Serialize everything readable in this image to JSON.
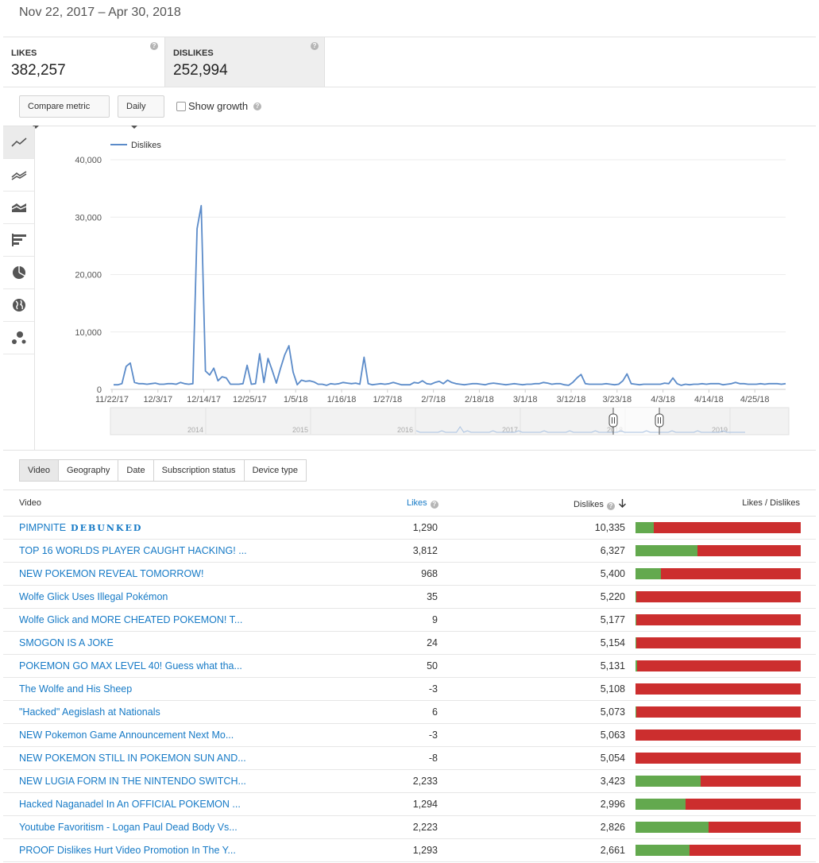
{
  "date_range": "Nov 22, 2017 – Apr 30, 2018",
  "metrics": [
    {
      "label": "LIKES",
      "value": "382,257",
      "help": "?"
    },
    {
      "label": "DISLIKES",
      "value": "252,994",
      "help": "?"
    }
  ],
  "controls": {
    "compare_metric": "Compare metric",
    "interval": "Daily",
    "show_growth": "Show growth",
    "help": "?"
  },
  "chart_icons": [
    "line-chart-icon",
    "multi-line-chart-icon",
    "stacked-area-chart-icon",
    "bar-chart-icon",
    "pie-chart-icon",
    "globe-map-icon",
    "bubble-chart-icon"
  ],
  "chart_data": {
    "type": "line",
    "legend": "Dislikes",
    "legend_color": "#5b8bc9",
    "ylim": [
      0,
      40000
    ],
    "yticks": [
      "40,000",
      "30,000",
      "20,000",
      "10,000",
      "0"
    ],
    "xticks": [
      "11/22/17",
      "12/3/17",
      "12/14/17",
      "12/25/17",
      "1/5/18",
      "1/16/18",
      "1/27/18",
      "2/7/18",
      "2/18/18",
      "3/1/18",
      "3/12/18",
      "3/23/18",
      "4/3/18",
      "4/14/18",
      "4/25/18"
    ],
    "grid": true,
    "series": [
      {
        "name": "Dislikes",
        "values": [
          800,
          800,
          1000,
          4000,
          4600,
          1200,
          1000,
          1000,
          900,
          1000,
          1100,
          900,
          900,
          1000,
          1000,
          900,
          1200,
          1000,
          900,
          1000,
          28000,
          32000,
          3200,
          2500,
          3700,
          1500,
          2200,
          2000,
          900,
          900,
          900,
          1000,
          4200,
          900,
          1000,
          6200,
          1200,
          5400,
          3300,
          1100,
          3700,
          6000,
          7600,
          3000,
          800,
          1600,
          1400,
          1500,
          1300,
          900,
          900,
          700,
          1000,
          900,
          1000,
          1200,
          1100,
          1000,
          1100,
          900,
          5600,
          1000,
          800,
          900,
          1000,
          900,
          1000,
          1200,
          1000,
          800,
          800,
          800,
          1200,
          1100,
          1500,
          1000,
          900,
          1200,
          1400,
          1000,
          1600,
          1200,
          1000,
          900,
          800,
          900,
          1000,
          1000,
          900,
          800,
          1000,
          1100,
          1000,
          900,
          800,
          900,
          1000,
          900,
          800,
          900,
          900,
          1000,
          1000,
          1200,
          1100,
          900,
          1000,
          1000,
          800,
          700,
          1200,
          2000,
          2600,
          1000,
          900,
          900,
          900,
          900,
          1000,
          900,
          800,
          900,
          1500,
          2700,
          1000,
          900,
          800,
          900,
          900,
          900,
          900,
          900,
          1100,
          1000,
          2000,
          1000,
          700,
          900,
          800,
          900,
          900,
          1000,
          900,
          1000,
          1000,
          1000,
          800,
          900,
          1000,
          1200,
          1000,
          1000,
          900,
          900,
          900,
          1000,
          900,
          1000,
          1000,
          1000,
          900,
          1000
        ]
      }
    ],
    "navigator": {
      "years": [
        "2014",
        "2015",
        "2016",
        "2017",
        "2018",
        "2019"
      ]
    }
  },
  "tabs": [
    "Video",
    "Geography",
    "Date",
    "Subscription status",
    "Device type"
  ],
  "table": {
    "headers": {
      "video": "Video",
      "likes": "Likes",
      "dislikes": "Dislikes",
      "ratio": "Likes / Dislikes"
    },
    "rows": [
      {
        "title": "PIMPNITE",
        "title_suffix": "DEBUNKED",
        "likes": "1,290",
        "dislikes": "10,335",
        "like_fraction": 0.111
      },
      {
        "title": "TOP 16 WORLDS PLAYER CAUGHT HACKING! ...",
        "likes": "3,812",
        "dislikes": "6,327",
        "like_fraction": 0.376
      },
      {
        "title": "NEW POKEMON REVEAL TOMORROW!",
        "likes": "968",
        "dislikes": "5,400",
        "like_fraction": 0.152
      },
      {
        "title": "Wolfe Glick Uses Illegal Pokémon",
        "likes": "35",
        "dislikes": "5,220",
        "like_fraction": 0.007
      },
      {
        "title": "Wolfe Glick and MORE CHEATED POKEMON! T...",
        "likes": "9",
        "dislikes": "5,177",
        "like_fraction": 0.002
      },
      {
        "title": "SMOGON IS A JOKE",
        "likes": "24",
        "dislikes": "5,154",
        "like_fraction": 0.005
      },
      {
        "title": "POKEMON GO MAX LEVEL 40! Guess what tha...",
        "likes": "50",
        "dislikes": "5,131",
        "like_fraction": 0.01
      },
      {
        "title": "The Wolfe and His Sheep",
        "likes": "-3",
        "dislikes": "5,108",
        "like_fraction": 0
      },
      {
        "title": "\"Hacked\" Aegislash at Nationals",
        "likes": "6",
        "dislikes": "5,073",
        "like_fraction": 0.001
      },
      {
        "title": "NEW Pokemon Game Announcement Next Mo...",
        "likes": "-3",
        "dislikes": "5,063",
        "like_fraction": 0
      },
      {
        "title": "NEW POKEMON STILL IN POKEMON SUN AND...",
        "likes": "-8",
        "dislikes": "5,054",
        "like_fraction": 0
      },
      {
        "title": "NEW LUGIA FORM IN THE NINTENDO SWITCH...",
        "likes": "2,233",
        "dislikes": "3,423",
        "like_fraction": 0.395
      },
      {
        "title": "Hacked Naganadel In An OFFICIAL POKEMON ...",
        "likes": "1,294",
        "dislikes": "2,996",
        "like_fraction": 0.302
      },
      {
        "title": "Youtube Favoritism - Logan Paul Dead Body Vs...",
        "likes": "2,223",
        "dislikes": "2,826",
        "like_fraction": 0.44
      },
      {
        "title": "PROOF Dislikes Hurt Video Promotion In The Y...",
        "likes": "1,293",
        "dislikes": "2,661",
        "like_fraction": 0.327
      }
    ]
  },
  "colors": {
    "link": "#167ac6",
    "like_bar": "#63a94e",
    "dislike_bar": "#cc2e2e",
    "line": "#5b8bc9"
  }
}
